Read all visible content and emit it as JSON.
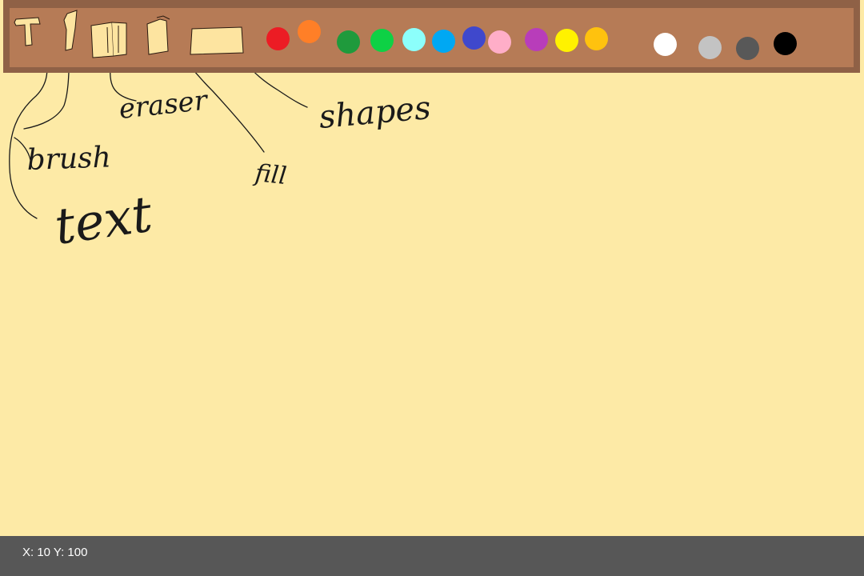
{
  "toolbar": {
    "tools": [
      {
        "name": "text",
        "icon": "text-tool-icon"
      },
      {
        "name": "brush",
        "icon": "brush-tool-icon"
      },
      {
        "name": "eraser",
        "icon": "eraser-tool-icon"
      },
      {
        "name": "fill",
        "icon": "fill-bucket-icon"
      },
      {
        "name": "shapes",
        "icon": "shapes-tool-icon"
      }
    ],
    "colors": [
      "#ec1c24",
      "#ff7f27",
      "#1f9a3c",
      "#0ed145",
      "#8cfffb",
      "#00a8f3",
      "#3f48cc",
      "#ffaec8",
      "#b83dba",
      "#fff200",
      "#ffc20e",
      "#ffffff",
      "#c3c3c3",
      "#585858",
      "#000000"
    ]
  },
  "annotations": {
    "text": "text",
    "brush": "brush",
    "eraser": "eraser",
    "fill": "fill",
    "shapes": "shapes"
  },
  "status": {
    "coordinates": "X: 10 Y: 100"
  },
  "theme": {
    "canvas_background": "#fdeaa6",
    "toolbar_frame": "#8f6146",
    "toolbar_background": "#b67b56",
    "statusbar_background": "#575757"
  }
}
